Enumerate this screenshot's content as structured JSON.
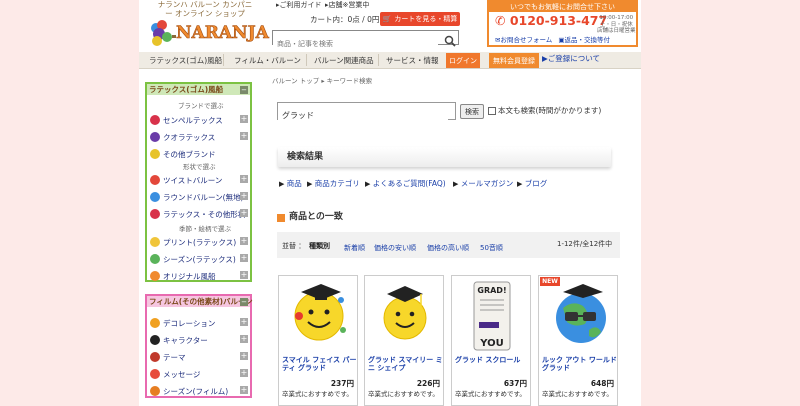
{
  "header": {
    "shop_sub": "ナランハ バルーン カンパニー オンライン ショップ",
    "logo_text": "NARANJA",
    "usage_guide": "ご利用ガイド",
    "store_open": "店舗※営業中",
    "cart_count": "カート内：0点 / 0円",
    "cart_button": "カートを見る・精算",
    "search_placeholder": "商品・記事を検索",
    "contact_top": "いつでもお気軽にお問合せ下さい",
    "tel": "0120-913-477",
    "hours": "10:00-17:00\n土・日・祝休\n店舗は日曜営業",
    "contact_form": "お問合せフォーム",
    "return_exchange": "返品・交換等付"
  },
  "nav": {
    "items": [
      "ラテックス(ゴム)風船",
      "フィルム・バルーン",
      "バルーン関連商品",
      "サービス・情報"
    ],
    "login": "ログイン",
    "member": "無料会員登録",
    "register": "ご登録について"
  },
  "sidebar": {
    "latex_head": "ラテックス(ゴム)風船",
    "latex_sub_brand": "ブランドで選ぶ",
    "latex_items": [
      {
        "label": "センペルテックス",
        "color": "#d8324a"
      },
      {
        "label": "クオラテックス",
        "color": "#6a3ca8"
      },
      {
        "label": "その他ブランド",
        "color": "#e7c32a"
      },
      {
        "label": "ツイストバルーン",
        "color": "#e3473a"
      },
      {
        "label": "ラウンドバルーン(無地)",
        "color": "#3a8fe0"
      },
      {
        "label": "ラテックス・その他形状",
        "color": "#d8324a"
      },
      {
        "label": "プリント(ラテックス)",
        "color": "#f0c53a"
      },
      {
        "label": "シーズン(ラテックス)",
        "color": "#5ab35a"
      },
      {
        "label": "オリジナル風船",
        "color": "#f08a2e"
      }
    ],
    "latex_sub_shape": "形状で選ぶ",
    "latex_sub_season": "季節・絵柄で選ぶ",
    "film_head": "フィルム(その他素材)バルーン",
    "film_items": [
      {
        "label": "デコレーション",
        "color": "#f0a020"
      },
      {
        "label": "キャラクター",
        "color": "#222222"
      },
      {
        "label": "テーマ",
        "color": "#c0392b"
      },
      {
        "label": "メッセージ",
        "color": "#e74c3c"
      },
      {
        "label": "シーズン(フィルム)",
        "color": "#e67e22"
      }
    ]
  },
  "main": {
    "breadcrumb_home": "バルーン トップ",
    "breadcrumb_current": "キーワード検索",
    "keyword": "グラッド",
    "search_button": "検索",
    "fulltext_label": "本文も検索(時間がかかります)",
    "result_title": "検索結果",
    "tabs": [
      "商品",
      "商品カテゴリ",
      "よくあるご質問(FAQ)",
      "メールマガジン",
      "ブログ"
    ],
    "section_title": "商品との一致",
    "sort_label": "並替",
    "sort_active": "種類別",
    "sort_options": [
      "新着順",
      "価格の安い順",
      "価格の高い順",
      "50音順"
    ],
    "count": "1-12件/全12件中"
  },
  "products": [
    {
      "name": "スマイル フェイス パーティ グラッド",
      "price": "237円",
      "desc": "卒業式におすすめです。"
    },
    {
      "name": "グラッド スマイリー ミニ シェイプ",
      "price": "226円",
      "desc": "卒業式におすすめです。"
    },
    {
      "name": "グラッド スクロール",
      "price": "637円",
      "desc": "卒業式におすすめです。",
      "card_text": [
        "GRAD!",
        "YOU"
      ]
    },
    {
      "name": "ルック アウト ワールド グラッド",
      "price": "648円",
      "desc": "卒業式におすすめです。",
      "badge": "NEW"
    }
  ]
}
